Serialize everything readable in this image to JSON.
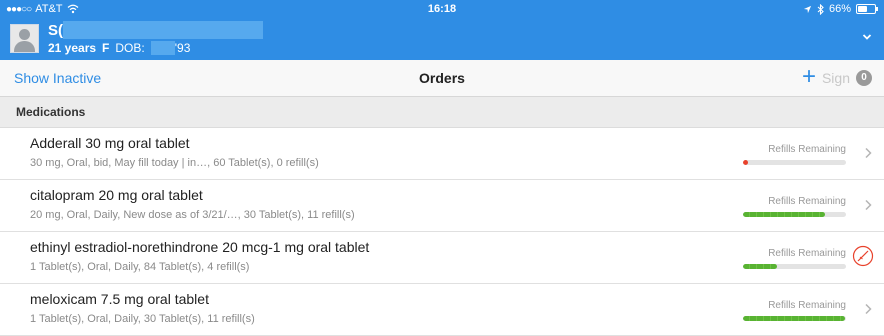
{
  "status_bar": {
    "signal": "●●●○○",
    "carrier": "AT&T",
    "time": "16:18",
    "battery": "66%",
    "battery_level": 0.66
  },
  "patient": {
    "name_initials": "S(",
    "age": "21 years",
    "sex": "F",
    "dob_label": "DOB:",
    "dob_suffix": "'93"
  },
  "nav": {
    "show_inactive": "Show Inactive",
    "title": "Orders",
    "add_glyph": "+",
    "sign_label": "Sign",
    "sign_count": "0"
  },
  "section": {
    "title": "Medications"
  },
  "medications": [
    {
      "name": "Adderall 30 mg oral tablet",
      "detail": "30 mg, Oral, bid, May fill today | in…, 60 Tablet(s), 0 refill(s)",
      "refill_label": "Refills Remaining",
      "refill_fraction": 0.05,
      "refill_color": "red",
      "action_icon": "chevron-right-icon"
    },
    {
      "name": "citalopram 20 mg oral tablet",
      "detail": "20 mg, Oral, Daily, New dose as of 3/21/…, 30 Tablet(s), 11 refill(s)",
      "refill_label": "Refills Remaining",
      "refill_fraction": 0.8,
      "refill_color": "green",
      "action_icon": "chevron-right-icon"
    },
    {
      "name": "ethinyl estradiol-norethindrone 20 mcg-1 mg oral tablet",
      "detail": "1 Tablet(s), Oral, Daily, 84 Tablet(s), 4 refill(s)",
      "refill_label": "Refills Remaining",
      "refill_fraction": 0.33,
      "refill_color": "green",
      "action_icon": "no-entry-icon"
    },
    {
      "name": "meloxicam 7.5 mg oral tablet",
      "detail": "1 Tablet(s), Oral, Daily, 30 Tablet(s), 11 refill(s)",
      "refill_label": "Refills Remaining",
      "refill_fraction": 0.99,
      "refill_color": "green",
      "action_icon": "chevron-right-icon"
    }
  ],
  "colors": {
    "accent": "#2f8de4",
    "refill_green": "#58b332",
    "refill_red": "#e8412b",
    "no_entry_red": "#e8412b"
  }
}
